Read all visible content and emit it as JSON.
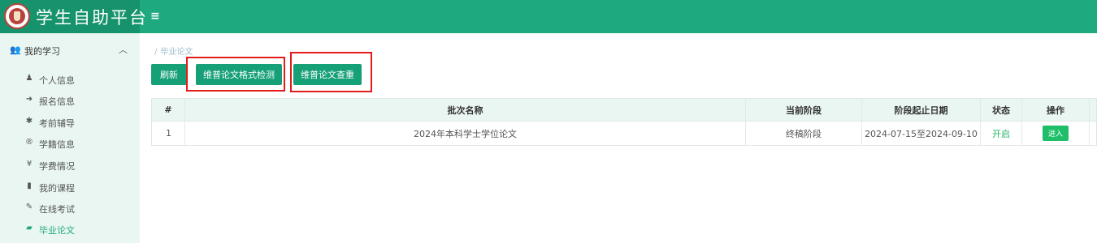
{
  "header": {
    "app_title": "学生自助平台",
    "menu_toggle": "≡"
  },
  "sidebar": {
    "group": {
      "label": "我的学习",
      "icon": "users-icon",
      "chevron": "︿"
    },
    "items": [
      {
        "label": "个人信息",
        "icon": "user-icon",
        "glyph": "♟"
      },
      {
        "label": "报名信息",
        "icon": "sign-in-icon",
        "glyph": "➜"
      },
      {
        "label": "考前辅导",
        "icon": "bug-icon",
        "glyph": "✱"
      },
      {
        "label": "学籍信息",
        "icon": "registered-icon",
        "glyph": "®"
      },
      {
        "label": "学费情况",
        "icon": "yen-icon",
        "glyph": "¥"
      },
      {
        "label": "我的课程",
        "icon": "book-icon",
        "glyph": "▮"
      },
      {
        "label": "在线考试",
        "icon": "pencil-icon",
        "glyph": "✎"
      },
      {
        "label": "毕业论文",
        "icon": "bookmark-icon",
        "glyph": "▰",
        "active": true
      }
    ]
  },
  "breadcrumb": {
    "separator": "/",
    "current": "毕业论文"
  },
  "toolbar": {
    "refresh": "刷新",
    "format_check": "维普论文格式检测",
    "plagiarism_check": "维普论文查重"
  },
  "table": {
    "headers": [
      "#",
      "批次名称",
      "当前阶段",
      "阶段起止日期",
      "状态",
      "操作"
    ],
    "rows": [
      {
        "index": "1",
        "batch_name": "2024年本科学士学位论文",
        "stage": "终稿阶段",
        "date_range": "2024-07-15至2024-09-10",
        "status": "开启",
        "action": "进入"
      }
    ]
  },
  "colors": {
    "brand": "#1fa97e",
    "logo_bg": "#16936c",
    "sidebar_bg": "#e9f6f1",
    "highlight_box": "#e21b1b",
    "status_open": "#27b36a"
  }
}
